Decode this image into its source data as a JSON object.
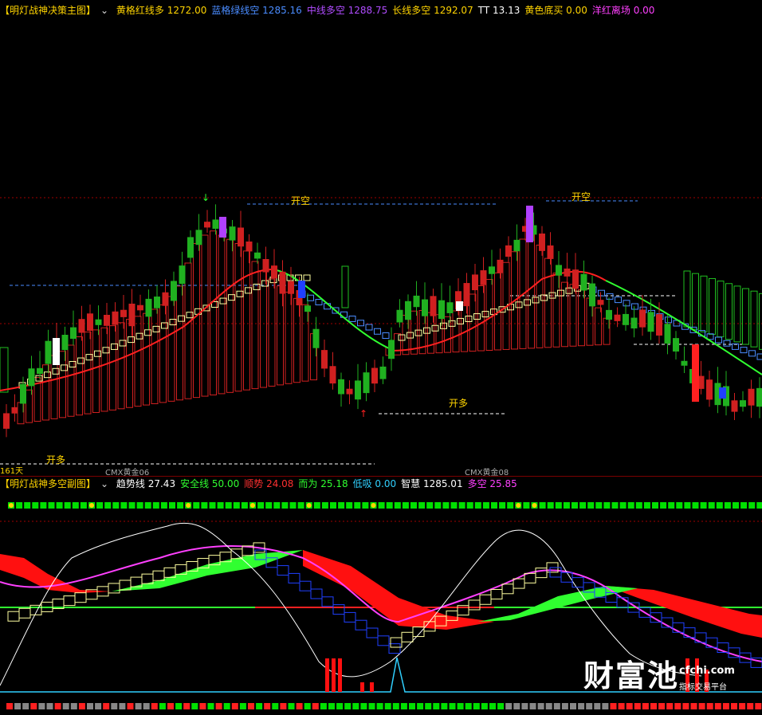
{
  "main_panel": {
    "title": "【明灯战神决策主图】",
    "dropdown_icon": "chevron-down-icon",
    "indicators": [
      {
        "label": "黄格红线多",
        "value": "1272.00",
        "color": "#ffd400"
      },
      {
        "label": "蓝格绿线空",
        "value": "1285.16",
        "color": "#4a8cff"
      },
      {
        "label": "中线多空",
        "value": "1288.75",
        "color": "#b04cff"
      },
      {
        "label": "长线多空",
        "value": "1292.07",
        "color": "#ffd400"
      },
      {
        "label": "TT",
        "value": "13.13",
        "color": "#ffffff"
      },
      {
        "label": "黄色底买",
        "value": "0.00",
        "color": "#ffd400"
      },
      {
        "label": "洋红离场",
        "value": "0.00",
        "color": "#ff40ff"
      }
    ],
    "signals": {
      "open_short_1": "开空",
      "open_short_2": "开空",
      "open_long_1": "开多",
      "open_long_2": "开多"
    },
    "bottom_left_label": "161天",
    "contract_label_1": "CMX黄金06",
    "contract_label_2": "CMX黄金08"
  },
  "sub_panel": {
    "title": "【明灯战神多空副图】",
    "dropdown_icon": "chevron-down-icon",
    "indicators": [
      {
        "label": "趋势线",
        "value": "27.43",
        "color": "#ffffff"
      },
      {
        "label": "安全线",
        "value": "50.00",
        "color": "#30ff30"
      },
      {
        "label": "顺势",
        "value": "24.08",
        "color": "#ff3030"
      },
      {
        "label": "而为",
        "value": "25.18",
        "color": "#30ff30"
      },
      {
        "label": "低吸",
        "value": "0.00",
        "color": "#30d0ff"
      },
      {
        "label": "智慧",
        "value": "1285.01",
        "color": "#ffffff"
      },
      {
        "label": "多空",
        "value": "25.85",
        "color": "#ff40ff"
      }
    ]
  },
  "watermark": {
    "big": "财富池",
    "site": "cfchi.com",
    "tag": "指标交易平台"
  },
  "colors": {
    "up": "#ff2020",
    "down": "#20c020",
    "divider": "#7a0000",
    "ma_red": "#ff2020",
    "ma_green": "#30ff30"
  }
}
